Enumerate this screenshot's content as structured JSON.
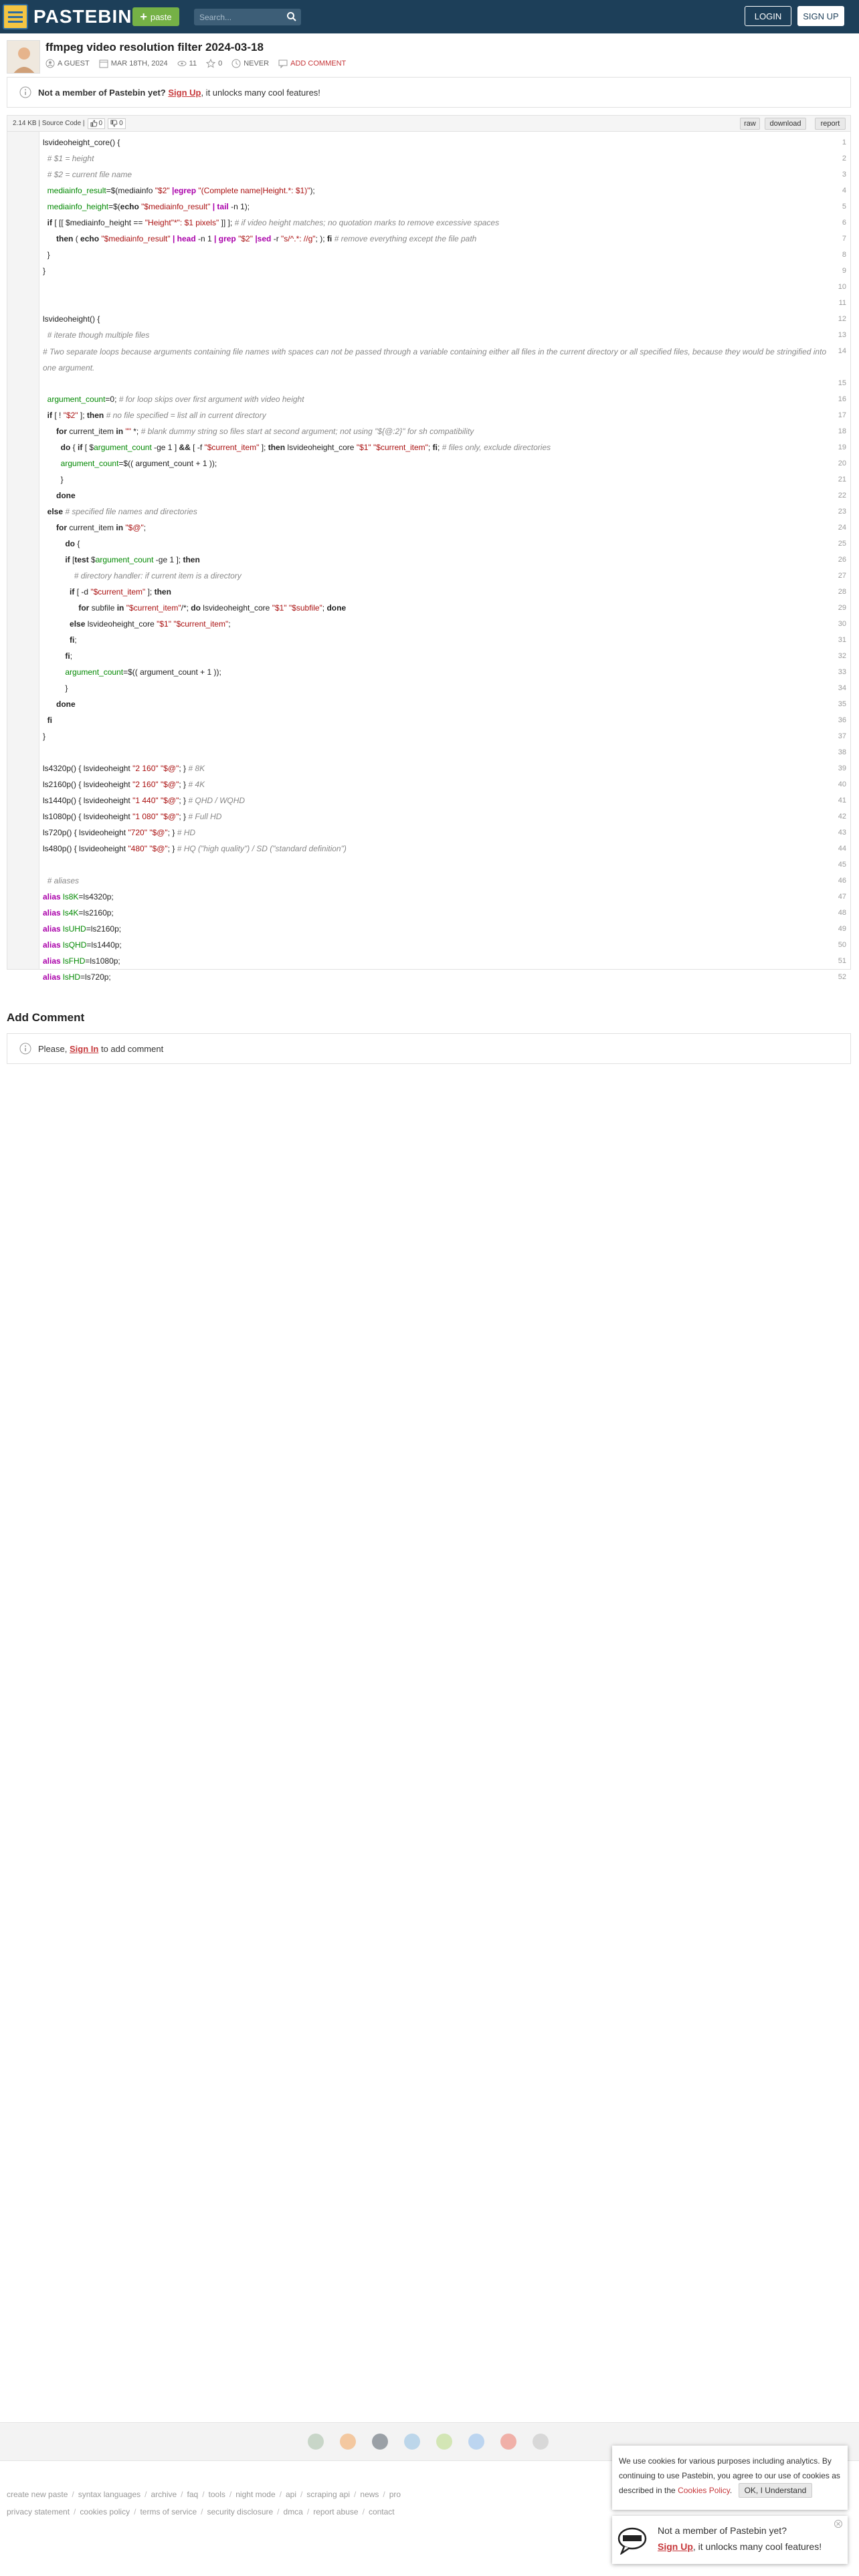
{
  "header": {
    "logo_text": "PASTEBIN",
    "paste_label": "paste",
    "search_placeholder": "Search...",
    "login_label": "LOGIN",
    "signup_label": "SIGN UP"
  },
  "paste": {
    "title": "ffmpeg video resolution filter 2024-03-18",
    "author": "A GUEST",
    "date": "MAR 18TH, 2024",
    "views": "11",
    "stars": "0",
    "expires": "NEVER",
    "add_comment": "ADD COMMENT"
  },
  "notice": {
    "bold": "Not a member of Pastebin yet?",
    "link": "Sign Up",
    "rest": ", it unlocks many cool features!"
  },
  "code_header": {
    "size": "2.14 KB",
    "separator": "|",
    "syntax": "Source Code",
    "trailing_sep": "|",
    "likes": "0",
    "dislikes": "0",
    "raw": "raw",
    "download": "download",
    "report": "report"
  },
  "lines": [
    {
      "n": "1",
      "html": "lsvideoheight_core() {"
    },
    {
      "n": "2",
      "html": "  <span class='t-c'># $1 = height</span>"
    },
    {
      "n": "3",
      "html": "  <span class='t-c'># $2 = current file name</span>"
    },
    {
      "n": "4",
      "html": "  <span class='t-v'>mediainfo_result</span>=$(mediainfo <span class='t-s'>\"$2\"</span> <span class='t-p'>|egrep</span> <span class='t-s'>\"(Complete name|Height.*: $1)\"</span>);"
    },
    {
      "n": "5",
      "html": "  <span class='t-v'>mediainfo_height</span>=$(<span class='t-k'>echo</span> <span class='t-s'>\"$mediainfo_result\"</span> <span class='t-p'>| tail</span> -n 1);"
    },
    {
      "n": "6",
      "html": "  <span class='t-k'>if</span> [ [[ $mediainfo_height == <span class='t-s'>\"Height\"*\": $1 pixels\"</span> ]] ]; <span class='t-c'># if video height matches; no quotation marks to remove excessive spaces</span>"
    },
    {
      "n": "7",
      "html": "      <span class='t-k'>then</span> ( <span class='t-k'>echo</span> <span class='t-s'>\"$mediainfo_result\"</span> <span class='t-p'>| head</span> -n 1 <span class='t-p'>| grep</span> <span class='t-s'>\"$2\"</span> <span class='t-p'>|sed</span> -r <span class='t-s'>\"s/^.*: //g\"</span>; ); <span class='t-k'>fi</span> <span class='t-c'># remove everything except the file path</span>"
    },
    {
      "n": "8",
      "html": "  }"
    },
    {
      "n": "9",
      "html": "}"
    },
    {
      "n": "10",
      "html": ""
    },
    {
      "n": "11",
      "html": ""
    },
    {
      "n": "12",
      "html": "lsvideoheight() {"
    },
    {
      "n": "13",
      "html": "  <span class='t-c'># iterate though multiple files</span>"
    },
    {
      "n": "14",
      "html": "  <span class='t-c'># Two separate loops because arguments containing file names with spaces can not be passed through a variable containing either all files in the current directory or all specified files, because they would be stringified into one argument.</span>",
      "wrap": true
    },
    {
      "n": "15",
      "html": ""
    },
    {
      "n": "16",
      "html": "  <span class='t-v'>argument_count</span>=0; <span class='t-c'># for loop skips over first argument with video height</span>"
    },
    {
      "n": "17",
      "html": "  <span class='t-k'>if</span> [ ! <span class='t-s'>\"$2\"</span> ]; <span class='t-k'>then</span> <span class='t-c'># no file specified = list all in current directory</span>"
    },
    {
      "n": "18",
      "html": "      <span class='t-k'>for</span> current_item <span class='t-k'>in</span> <span class='t-s'>\"\"</span> *; <span class='t-c'># blank dummy string so files start at second argument; not using \"${@:2}\" for sh compatibility</span>"
    },
    {
      "n": "19",
      "html": "        <span class='t-k'>do</span> { <span class='t-k'>if</span> [ $<span class='t-v'>argument_count</span> -ge 1 ] <span class='t-k'>&amp;&amp;</span> [ -f <span class='t-s'>\"$current_item\"</span> ]; <span class='t-k'>then</span> lsvideoheight_core <span class='t-s'>\"$1\"</span> <span class='t-s'>\"$current_item\"</span>; <span class='t-k'>fi</span>; <span class='t-c'># files only, exclude directories</span>"
    },
    {
      "n": "20",
      "html": "        <span class='t-v'>argument_count</span>=$(( argument_count + 1 ));"
    },
    {
      "n": "21",
      "html": "        }"
    },
    {
      "n": "22",
      "html": "      <span class='t-k'>done</span>"
    },
    {
      "n": "23",
      "html": "  <span class='t-k'>else</span> <span class='t-c'># specified file names and directories</span>"
    },
    {
      "n": "24",
      "html": "      <span class='t-k'>for</span> current_item <span class='t-k'>in</span> <span class='t-s'>\"$@\"</span>;"
    },
    {
      "n": "25",
      "html": "          <span class='t-k'>do</span> {"
    },
    {
      "n": "26",
      "html": "          <span class='t-k'>if</span> [<span class='t-k'>test</span> $<span class='t-v'>argument_count</span> -ge 1 ]; <span class='t-k'>then</span>"
    },
    {
      "n": "27",
      "html": "              <span class='t-c'># directory handler: if current item is a directory</span>"
    },
    {
      "n": "28",
      "html": "            <span class='t-k'>if</span> [ -d <span class='t-s'>\"$current_item\"</span> ]; <span class='t-k'>then</span>"
    },
    {
      "n": "29",
      "html": "                <span class='t-k'>for</span> subfile <span class='t-k'>in</span> <span class='t-s'>\"$current_item\"</span>/*; <span class='t-k'>do</span> lsvideoheight_core <span class='t-s'>\"$1\"</span> <span class='t-s'>\"$subfile\"</span>; <span class='t-k'>done</span>"
    },
    {
      "n": "30",
      "html": "            <span class='t-k'>else</span> lsvideoheight_core <span class='t-s'>\"$1\"</span> <span class='t-s'>\"$current_item\"</span>;"
    },
    {
      "n": "31",
      "html": "            <span class='t-k'>fi</span>;"
    },
    {
      "n": "32",
      "html": "          <span class='t-k'>fi</span>;"
    },
    {
      "n": "33",
      "html": "          <span class='t-v'>argument_count</span>=$(( argument_count + 1 ));"
    },
    {
      "n": "34",
      "html": "          }"
    },
    {
      "n": "35",
      "html": "      <span class='t-k'>done</span>"
    },
    {
      "n": "36",
      "html": "  <span class='t-k'>fi</span>"
    },
    {
      "n": "37",
      "html": "}"
    },
    {
      "n": "38",
      "html": ""
    },
    {
      "n": "39",
      "html": "ls4320p() { lsvideoheight <span class='t-s'>\"2 160\"</span> <span class='t-s'>\"$@\"</span>; } <span class='t-c'># 8K</span>"
    },
    {
      "n": "40",
      "html": "ls2160p() { lsvideoheight <span class='t-s'>\"2 160\"</span> <span class='t-s'>\"$@\"</span>; } <span class='t-c'># 4K</span>"
    },
    {
      "n": "41",
      "html": "ls1440p() { lsvideoheight <span class='t-s'>\"1 440\"</span> <span class='t-s'>\"$@\"</span>; } <span class='t-c'># QHD / WQHD</span>"
    },
    {
      "n": "42",
      "html": "ls1080p() { lsvideoheight <span class='t-s'>\"1 080\"</span> <span class='t-s'>\"$@\"</span>; } <span class='t-c'># Full HD</span>"
    },
    {
      "n": "43",
      "html": "ls720p() { lsvideoheight <span class='t-s'>\"720\"</span> <span class='t-s'>\"$@\"</span>; } <span class='t-c'># HD</span>"
    },
    {
      "n": "44",
      "html": "ls480p() { lsvideoheight <span class='t-s'>\"480\"</span> <span class='t-s'>\"$@\"</span>; } <span class='t-c'># HQ (\"high quality\") / SD (\"standard definition\")</span>"
    },
    {
      "n": "45",
      "html": ""
    },
    {
      "n": "46",
      "html": "  <span class='t-c'># aliases</span>"
    },
    {
      "n": "47",
      "html": "<span class='t-p'>alias</span> <span class='t-v'>ls8K</span>=ls4320p;"
    },
    {
      "n": "48",
      "html": "<span class='t-p'>alias</span> <span class='t-v'>ls4K</span>=ls2160p;"
    },
    {
      "n": "49",
      "html": "<span class='t-p'>alias</span> <span class='t-v'>lsUHD</span>=ls2160p;"
    },
    {
      "n": "50",
      "html": "<span class='t-p'>alias</span> <span class='t-v'>lsQHD</span>=ls1440p;"
    },
    {
      "n": "51",
      "html": "<span class='t-p'>alias</span> <span class='t-v'>lsFHD</span>=ls1080p;"
    },
    {
      "n": "52",
      "html": "<span class='t-p'>alias</span> <span class='t-v'>lsHD</span>=ls720p;"
    }
  ],
  "comments": {
    "title": "Add Comment",
    "please": "Please,",
    "signin": "Sign In",
    "rest": "to add comment"
  },
  "footer": {
    "row1": [
      "create new paste",
      "syntax languages",
      "archive",
      "faq",
      "tools",
      "night mode",
      "api",
      "scraping api",
      "news",
      "pro"
    ],
    "row2": [
      "privacy statement",
      "cookies policy",
      "terms of service",
      "security disclosure",
      "dmca",
      "report abuse",
      "contact"
    ]
  },
  "cookie": {
    "text": "We use cookies for various purposes including analytics. By continuing to use Pastebin, you agree to our use of cookies as described in the",
    "link": "Cookies Policy",
    "end": ".",
    "ok": "OK, I Understand"
  },
  "promo": {
    "line1": "Not a member of Pastebin yet?",
    "link": "Sign Up",
    "rest": ", it unlocks many cool features!"
  }
}
